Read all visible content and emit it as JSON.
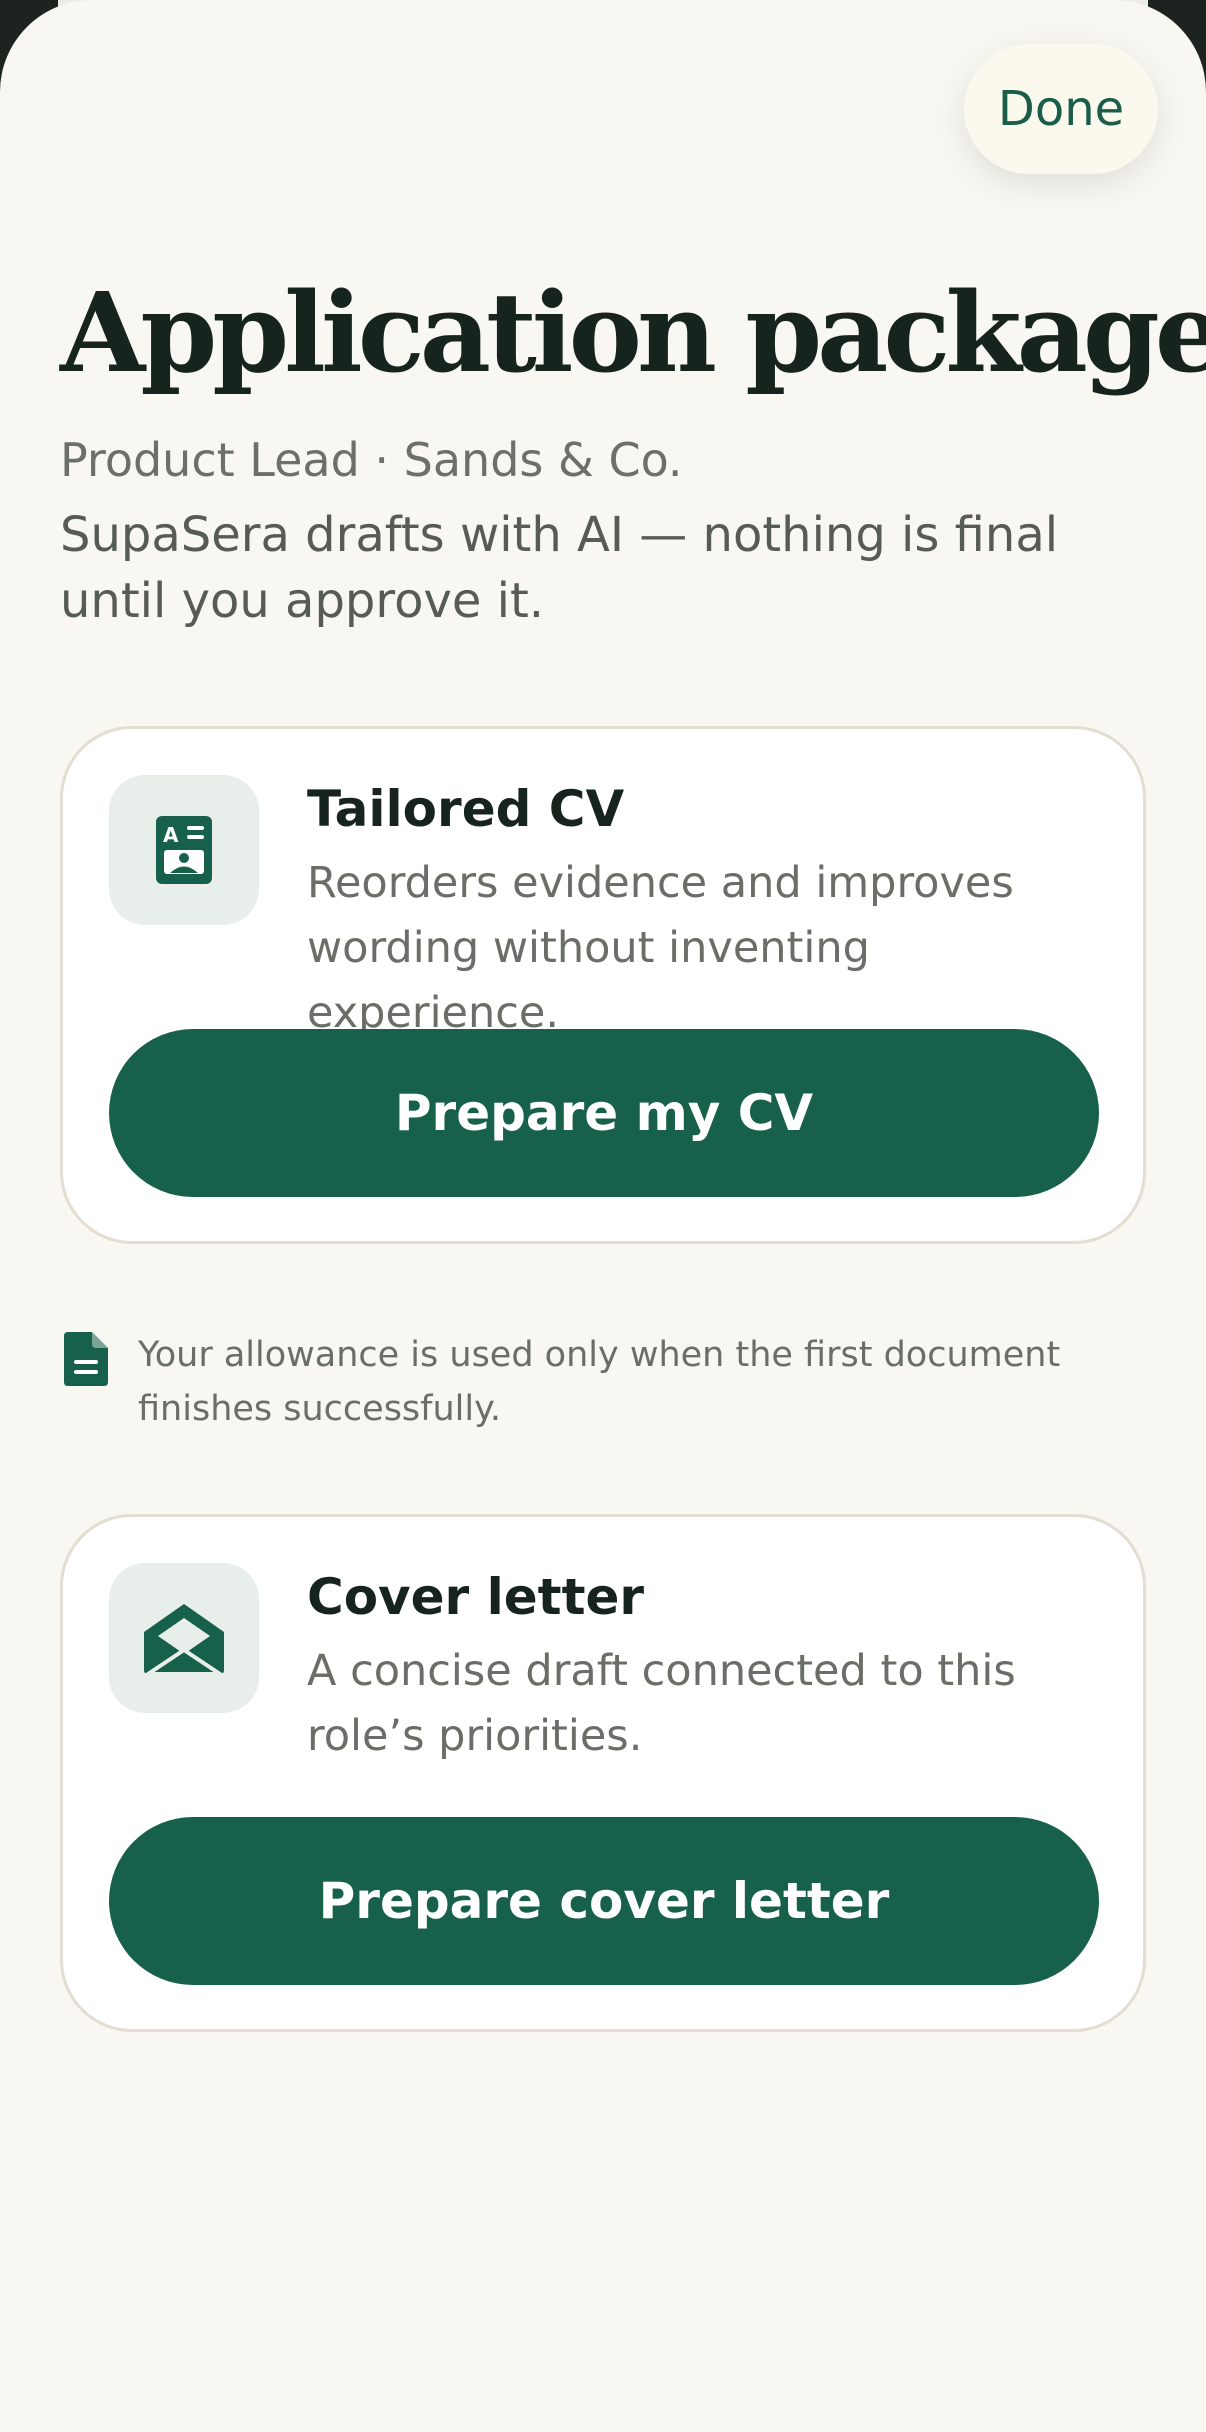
{
  "header": {
    "done_label": "Done"
  },
  "page": {
    "title": "Application package",
    "subtitle": "Product Lead · Sands & Co.",
    "disclaimer": "SupaSera drafts with AI — nothing is final until you approve it."
  },
  "cards": [
    {
      "icon": "cv-document-icon",
      "title": "Tailored CV",
      "description": "Reorders evidence and improves wording without inventing experience.",
      "button_label": "Prepare my CV"
    },
    {
      "icon": "envelope-icon",
      "title": "Cover letter",
      "description": "A concise draft connected to this role’s priorities.",
      "button_label": "Prepare cover letter"
    }
  ],
  "note": {
    "icon": "document-icon",
    "text": "Your allowance is used only when the first document finishes successfully."
  },
  "colors": {
    "accent": "#17604b",
    "background": "#f8f7f2",
    "text": "#17241e"
  }
}
